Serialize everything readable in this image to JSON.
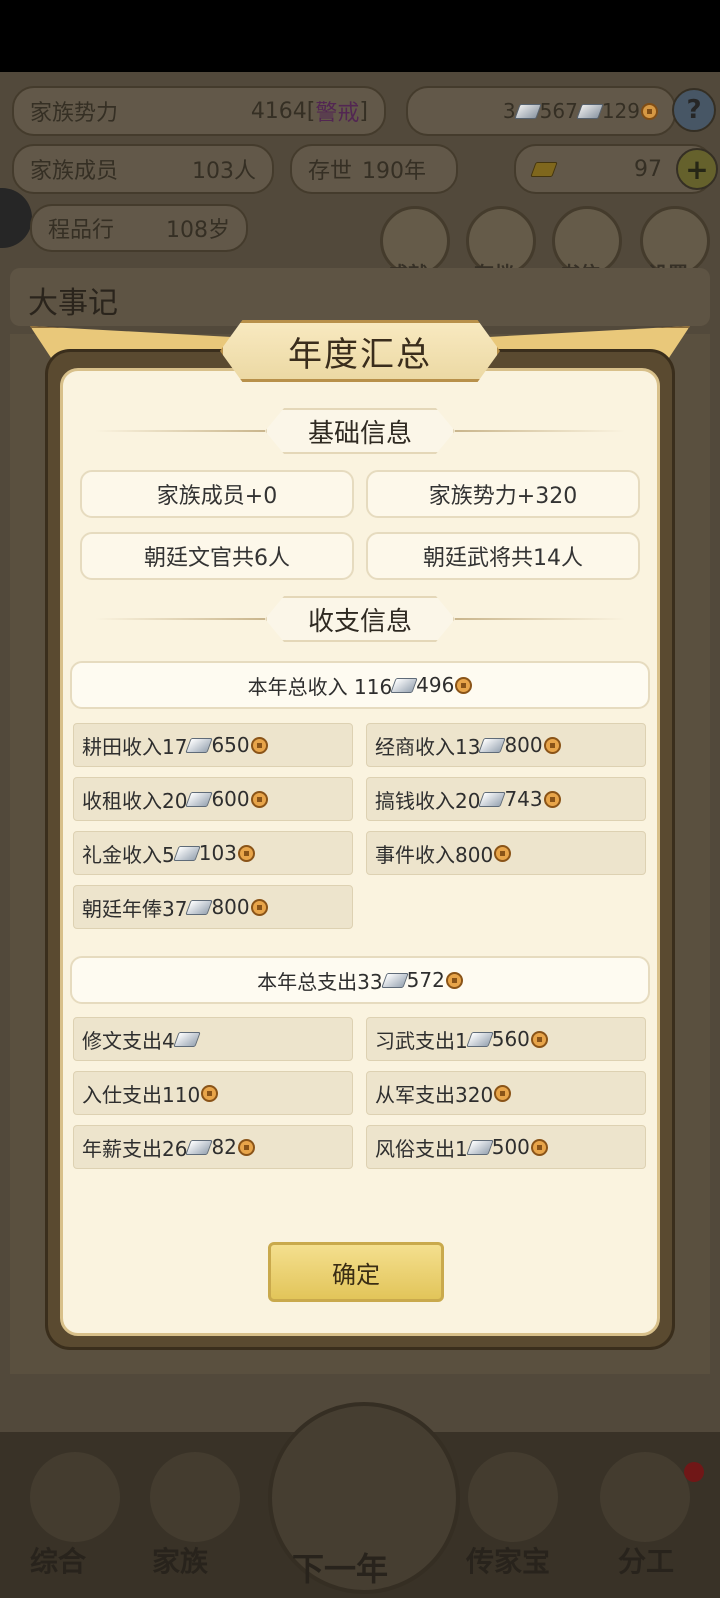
{
  "background": {
    "family_power": {
      "label": "家族势力",
      "value": "4164[",
      "rank": "警戒",
      "close": "]"
    },
    "currency": {
      "gold": "3",
      "silver": "567",
      "coin": "129"
    },
    "help": "?",
    "family_members": {
      "label": "家族成员",
      "value": "103人"
    },
    "survival": {
      "label": "存世",
      "value": "190年"
    },
    "yuanbao": {
      "value": "97",
      "plus": "+"
    },
    "elder": {
      "label": "程品行",
      "age": "108岁"
    },
    "round_buttons": [
      "成就",
      "存档",
      "书信",
      "设置"
    ],
    "chronicle_title": "大事记",
    "bottom_nav": [
      "综合",
      "家族",
      "下一年",
      "传家宝",
      "分工"
    ]
  },
  "modal": {
    "title": "年度汇总",
    "basic_section": "基础信息",
    "basic": [
      "家族成员+0",
      "家族势力+320",
      "朝廷文官共6人",
      "朝廷武将共14人"
    ],
    "finance_section": "收支信息",
    "income_total": {
      "label": "本年总收入 116",
      "coin": "496"
    },
    "income_items": [
      {
        "label": "耕田收入17",
        "coin": "650"
      },
      {
        "label": "经商收入13",
        "coin": "800"
      },
      {
        "label": "收租收入20",
        "coin": "600"
      },
      {
        "label": "搞钱收入20",
        "coin": "743"
      },
      {
        "label": "礼金收入5",
        "coin": "103"
      },
      {
        "label": "事件收入800",
        "coin": ""
      },
      {
        "label": "朝廷年俸37",
        "coin": "800"
      }
    ],
    "expense_total": {
      "label": "本年总支出33",
      "coin": "572"
    },
    "expense_items": [
      {
        "label": "修文支出4",
        "coin": ""
      },
      {
        "label": "习武支出1",
        "coin": "560"
      },
      {
        "label": "入仕支出110",
        "coin": ""
      },
      {
        "label": "从军支出320",
        "coin": ""
      },
      {
        "label": "年薪支出26",
        "coin": "82"
      },
      {
        "label": "风俗支出1",
        "coin": "500"
      }
    ],
    "confirm": "确定"
  }
}
